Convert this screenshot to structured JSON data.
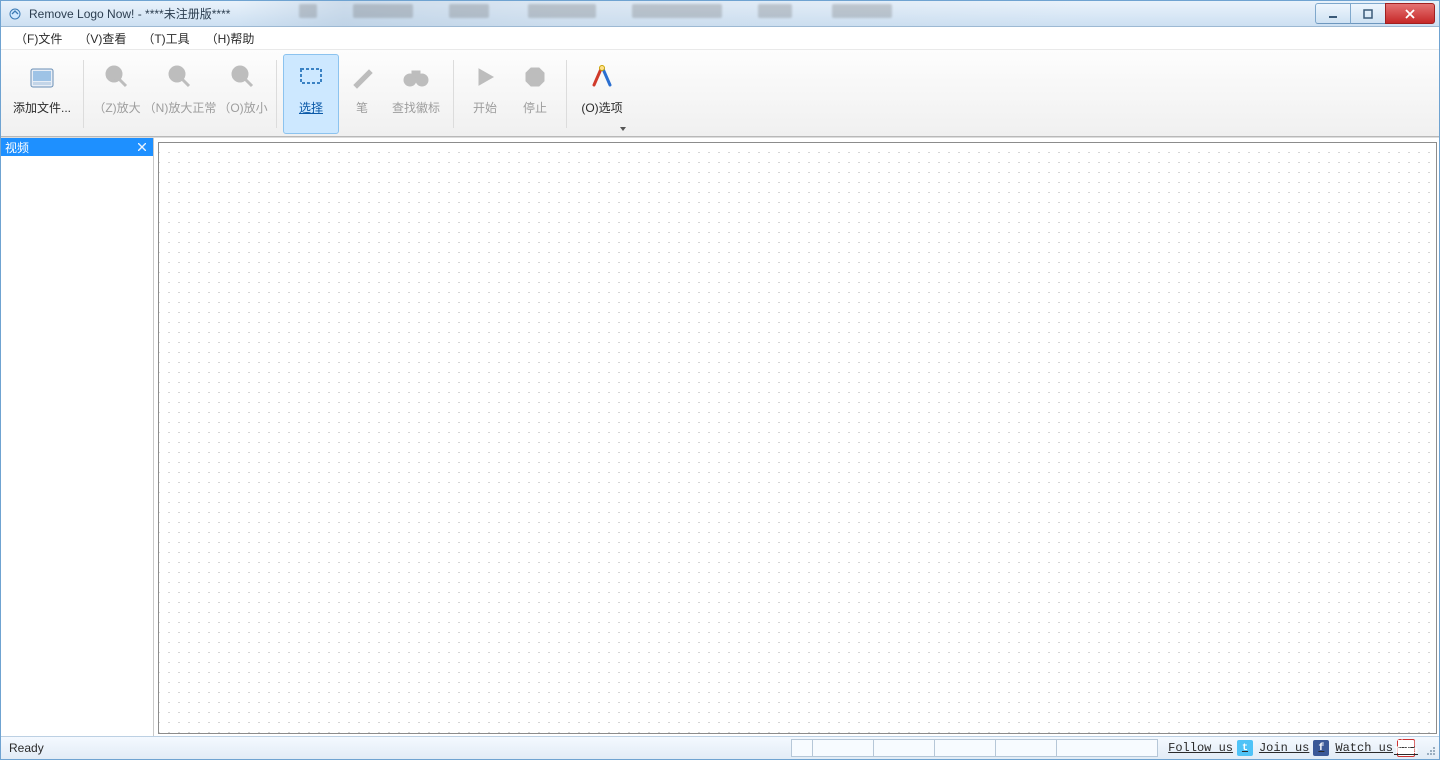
{
  "window": {
    "title": "Remove Logo Now! - ****未注册版****"
  },
  "menu": {
    "file": "（F)文件",
    "view": "（V)查看",
    "tools": "（T)工具",
    "help": "（H)帮助"
  },
  "toolbar": {
    "add_files": "添加文件...",
    "zoom_in": "（Z)放大",
    "zoom_100": "（N)放大正常",
    "zoom_out": "（O)放小",
    "select": "选择",
    "pen": "笔",
    "find_logo": "查找徽标",
    "start": "开始",
    "stop": "停止",
    "options": "(O)选项"
  },
  "sidebar": {
    "title": "视频"
  },
  "statusbar": {
    "ready": "Ready",
    "follow": "Follow us",
    "join": "Join us",
    "watch": "Watch us"
  }
}
